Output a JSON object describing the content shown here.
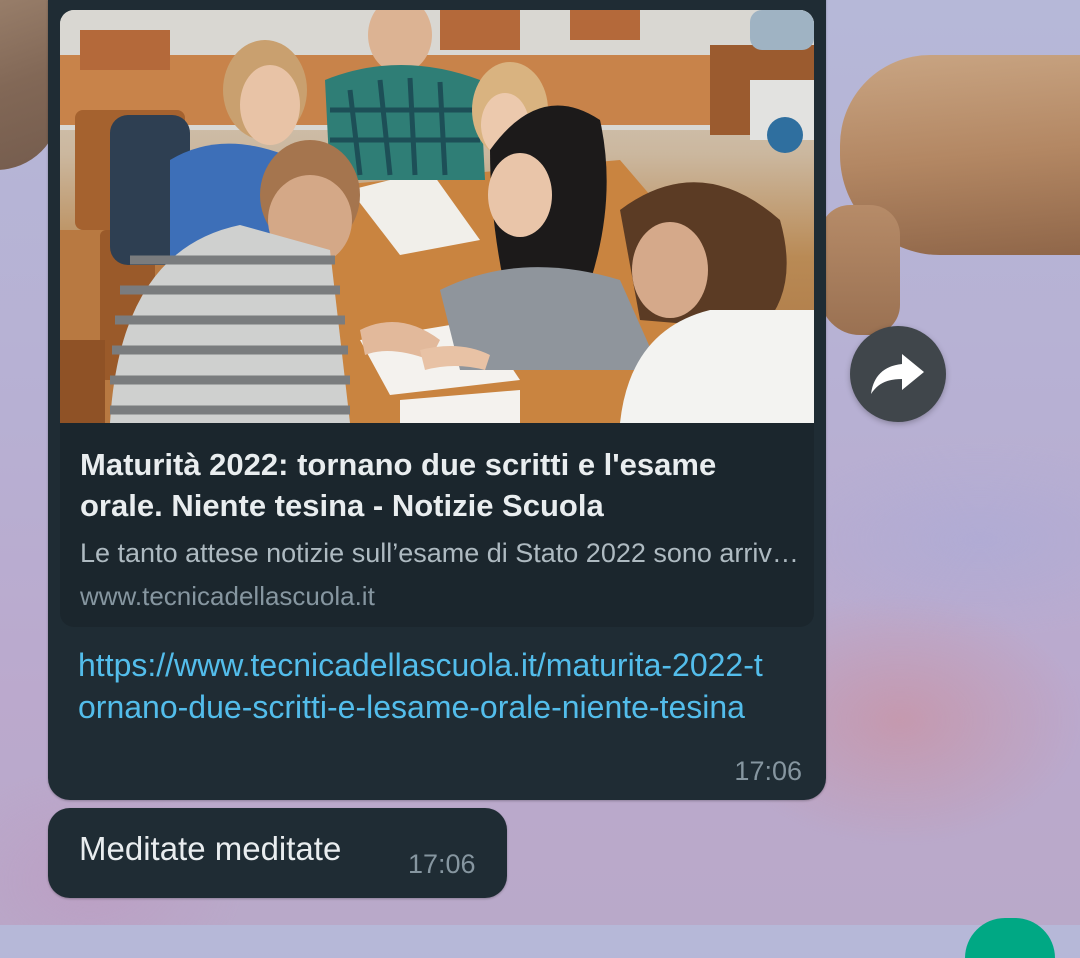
{
  "link_message": {
    "preview": {
      "title": "Maturità 2022: tornano due scritti e l'esame orale. Niente tesina - Notizie Scuola",
      "description": "Le tanto attese notizie sull’esame di Stato 2022 sono arrivate",
      "domain": "www.tecnicadellascuola.it",
      "image": "photo-students-at-table"
    },
    "url": "https://www.tecnicadellascuola.it/maturita-2022-tornano-due-scritti-e-lesame-orale-niente-tesina",
    "time": "17:06"
  },
  "text_message": {
    "text": "Meditate meditate",
    "time": "17:06"
  },
  "forward_button": {
    "icon": "forward-arrow-icon"
  },
  "colors": {
    "bubble": "#1f2c34",
    "link": "#53bdeb",
    "text": "#e9edef",
    "meta": "#8696a0"
  }
}
